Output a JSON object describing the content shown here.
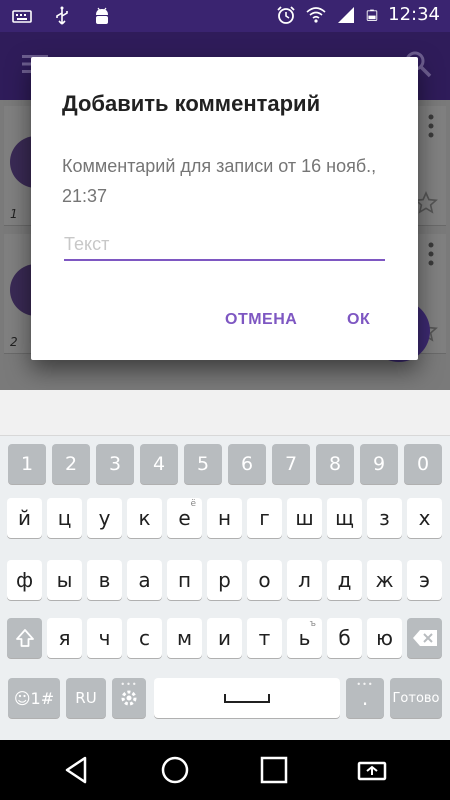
{
  "status_bar": {
    "time": "12:34",
    "left_icons": [
      "keyboard-icon",
      "usb-icon",
      "android-debug-icon"
    ],
    "right_icons": [
      "alarm-icon",
      "wifi-icon",
      "signal-icon",
      "battery-icon"
    ]
  },
  "background": {
    "list_items": [
      {
        "number": "1"
      },
      {
        "number": "2"
      }
    ]
  },
  "dialog": {
    "title": "Добавить комментарий",
    "message": "Комментарий для записи от 16 нояб., 21:37",
    "input_placeholder": "Текст",
    "input_value": "",
    "cancel_label": "ОТМЕНА",
    "ok_label": "ОК"
  },
  "keyboard": {
    "number_row": [
      "1",
      "2",
      "3",
      "4",
      "5",
      "6",
      "7",
      "8",
      "9",
      "0"
    ],
    "row1": [
      "й",
      "ц",
      "у",
      "к",
      "е",
      "н",
      "г",
      "ш",
      "щ",
      "з",
      "х"
    ],
    "row1_hint_e": "ё",
    "row2": [
      "ф",
      "ы",
      "в",
      "а",
      "п",
      "р",
      "о",
      "л",
      "д",
      "ж",
      "э"
    ],
    "row3": [
      "я",
      "ч",
      "с",
      "м",
      "и",
      "т",
      "ь",
      "б",
      "ю"
    ],
    "row3_hint_soft": "ъ",
    "emoji_label": "☺1#",
    "lang_label": "RU",
    "period_label": ".",
    "done_label": "Готово"
  },
  "nav_bar": {
    "icons": [
      "back-icon",
      "home-icon",
      "recents-icon",
      "rotate-icon"
    ]
  },
  "colors": {
    "accent": "#7e57c2",
    "status_bar": "#3a2470",
    "dialog_bg": "#ffffff",
    "keyboard_bg": "#eceff1",
    "key_fn": "#b8bcbf"
  }
}
